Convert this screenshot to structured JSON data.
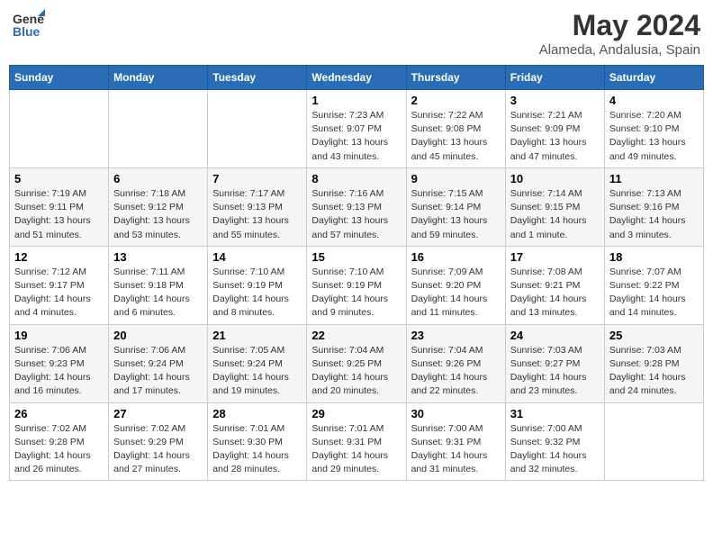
{
  "header": {
    "logo_general": "General",
    "logo_blue": "Blue",
    "title": "May 2024",
    "subtitle": "Alameda, Andalusia, Spain"
  },
  "days_of_week": [
    "Sunday",
    "Monday",
    "Tuesday",
    "Wednesday",
    "Thursday",
    "Friday",
    "Saturday"
  ],
  "weeks": [
    [
      {
        "day": "",
        "info": ""
      },
      {
        "day": "",
        "info": ""
      },
      {
        "day": "",
        "info": ""
      },
      {
        "day": "1",
        "info": "Sunrise: 7:23 AM\nSunset: 9:07 PM\nDaylight: 13 hours\nand 43 minutes."
      },
      {
        "day": "2",
        "info": "Sunrise: 7:22 AM\nSunset: 9:08 PM\nDaylight: 13 hours\nand 45 minutes."
      },
      {
        "day": "3",
        "info": "Sunrise: 7:21 AM\nSunset: 9:09 PM\nDaylight: 13 hours\nand 47 minutes."
      },
      {
        "day": "4",
        "info": "Sunrise: 7:20 AM\nSunset: 9:10 PM\nDaylight: 13 hours\nand 49 minutes."
      }
    ],
    [
      {
        "day": "5",
        "info": "Sunrise: 7:19 AM\nSunset: 9:11 PM\nDaylight: 13 hours\nand 51 minutes."
      },
      {
        "day": "6",
        "info": "Sunrise: 7:18 AM\nSunset: 9:12 PM\nDaylight: 13 hours\nand 53 minutes."
      },
      {
        "day": "7",
        "info": "Sunrise: 7:17 AM\nSunset: 9:13 PM\nDaylight: 13 hours\nand 55 minutes."
      },
      {
        "day": "8",
        "info": "Sunrise: 7:16 AM\nSunset: 9:13 PM\nDaylight: 13 hours\nand 57 minutes."
      },
      {
        "day": "9",
        "info": "Sunrise: 7:15 AM\nSunset: 9:14 PM\nDaylight: 13 hours\nand 59 minutes."
      },
      {
        "day": "10",
        "info": "Sunrise: 7:14 AM\nSunset: 9:15 PM\nDaylight: 14 hours\nand 1 minute."
      },
      {
        "day": "11",
        "info": "Sunrise: 7:13 AM\nSunset: 9:16 PM\nDaylight: 14 hours\nand 3 minutes."
      }
    ],
    [
      {
        "day": "12",
        "info": "Sunrise: 7:12 AM\nSunset: 9:17 PM\nDaylight: 14 hours\nand 4 minutes."
      },
      {
        "day": "13",
        "info": "Sunrise: 7:11 AM\nSunset: 9:18 PM\nDaylight: 14 hours\nand 6 minutes."
      },
      {
        "day": "14",
        "info": "Sunrise: 7:10 AM\nSunset: 9:19 PM\nDaylight: 14 hours\nand 8 minutes."
      },
      {
        "day": "15",
        "info": "Sunrise: 7:10 AM\nSunset: 9:19 PM\nDaylight: 14 hours\nand 9 minutes."
      },
      {
        "day": "16",
        "info": "Sunrise: 7:09 AM\nSunset: 9:20 PM\nDaylight: 14 hours\nand 11 minutes."
      },
      {
        "day": "17",
        "info": "Sunrise: 7:08 AM\nSunset: 9:21 PM\nDaylight: 14 hours\nand 13 minutes."
      },
      {
        "day": "18",
        "info": "Sunrise: 7:07 AM\nSunset: 9:22 PM\nDaylight: 14 hours\nand 14 minutes."
      }
    ],
    [
      {
        "day": "19",
        "info": "Sunrise: 7:06 AM\nSunset: 9:23 PM\nDaylight: 14 hours\nand 16 minutes."
      },
      {
        "day": "20",
        "info": "Sunrise: 7:06 AM\nSunset: 9:24 PM\nDaylight: 14 hours\nand 17 minutes."
      },
      {
        "day": "21",
        "info": "Sunrise: 7:05 AM\nSunset: 9:24 PM\nDaylight: 14 hours\nand 19 minutes."
      },
      {
        "day": "22",
        "info": "Sunrise: 7:04 AM\nSunset: 9:25 PM\nDaylight: 14 hours\nand 20 minutes."
      },
      {
        "day": "23",
        "info": "Sunrise: 7:04 AM\nSunset: 9:26 PM\nDaylight: 14 hours\nand 22 minutes."
      },
      {
        "day": "24",
        "info": "Sunrise: 7:03 AM\nSunset: 9:27 PM\nDaylight: 14 hours\nand 23 minutes."
      },
      {
        "day": "25",
        "info": "Sunrise: 7:03 AM\nSunset: 9:28 PM\nDaylight: 14 hours\nand 24 minutes."
      }
    ],
    [
      {
        "day": "26",
        "info": "Sunrise: 7:02 AM\nSunset: 9:28 PM\nDaylight: 14 hours\nand 26 minutes."
      },
      {
        "day": "27",
        "info": "Sunrise: 7:02 AM\nSunset: 9:29 PM\nDaylight: 14 hours\nand 27 minutes."
      },
      {
        "day": "28",
        "info": "Sunrise: 7:01 AM\nSunset: 9:30 PM\nDaylight: 14 hours\nand 28 minutes."
      },
      {
        "day": "29",
        "info": "Sunrise: 7:01 AM\nSunset: 9:31 PM\nDaylight: 14 hours\nand 29 minutes."
      },
      {
        "day": "30",
        "info": "Sunrise: 7:00 AM\nSunset: 9:31 PM\nDaylight: 14 hours\nand 31 minutes."
      },
      {
        "day": "31",
        "info": "Sunrise: 7:00 AM\nSunset: 9:32 PM\nDaylight: 14 hours\nand 32 minutes."
      },
      {
        "day": "",
        "info": ""
      }
    ]
  ]
}
